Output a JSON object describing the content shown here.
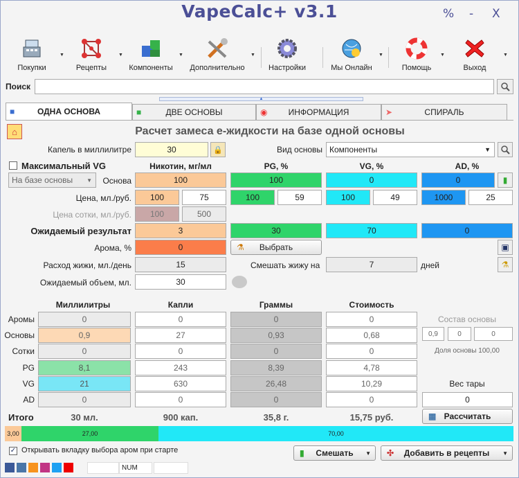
{
  "app": {
    "title": "VapeCalc+ v3.1",
    "ctl_percent": "%",
    "ctl_min": "-",
    "ctl_close": "X"
  },
  "toolbar": [
    {
      "label": "Покупки",
      "icon": "register-icon"
    },
    {
      "label": "Рецепты",
      "icon": "molecule-icon"
    },
    {
      "label": "Компоненты",
      "icon": "puzzle-icon"
    },
    {
      "label": "Дополнительно",
      "icon": "tools-icon"
    },
    {
      "label": "Настройки",
      "icon": "gear-icon"
    },
    {
      "label": "Мы Онлайн",
      "icon": "globe-icon"
    },
    {
      "label": "Помощь",
      "icon": "lifebuoy-icon"
    },
    {
      "label": "Выход",
      "icon": "exit-icon"
    }
  ],
  "search": {
    "label": "Поиск",
    "value": ""
  },
  "tabs": [
    {
      "label": "ОДНА ОСНОВА",
      "active": true
    },
    {
      "label": "ДВЕ ОСНОВЫ",
      "active": false
    },
    {
      "label": "ИНФОРМАЦИЯ",
      "active": false
    },
    {
      "label": "СПИРАЛЬ",
      "active": false
    }
  ],
  "heading": "Расчет замеса е-жидкости на базе одной основы",
  "drops": {
    "label": "Капель в миллилитре",
    "value": "30"
  },
  "base_type": {
    "label": "Вид основы",
    "value": "Компоненты"
  },
  "max_vg": {
    "label": "Максимальный VG",
    "checked": false
  },
  "base_select": "На базе основы",
  "col_headers": {
    "nic": "Никотин, мг/мл",
    "pg": "PG, %",
    "vg": "VG, %",
    "ad": "AD, %"
  },
  "rows": {
    "base": {
      "label": "Основа",
      "nic": "100",
      "pg": "100",
      "vg": "0",
      "ad": "0"
    },
    "price": {
      "label": "Цена, мл./руб.",
      "nic_ml": "100",
      "nic_rub": "75",
      "pg_ml": "100",
      "pg_rub": "59",
      "vg_ml": "100",
      "vg_rub": "49",
      "ad_ml": "1000",
      "ad_rub": "25"
    },
    "hundred": {
      "label": "Цена сотки, мл./руб.",
      "ml": "100",
      "rub": "500"
    },
    "expected": {
      "label": "Ожидаемый результат",
      "nic": "3",
      "pg": "30",
      "vg": "70",
      "ad": "0"
    },
    "aroma": {
      "label": "Арома, %",
      "value": "0",
      "choose": "Выбрать"
    },
    "consumption": {
      "label": "Расход жижи, мл./день",
      "value": "15"
    },
    "mix_days": {
      "label": "Смешать жижу на",
      "value": "7",
      "unit": "дней"
    },
    "volume": {
      "label": "Ожидаемый объем, мл.",
      "value": "30"
    }
  },
  "results": {
    "headers": {
      "ml": "Миллилитры",
      "drops": "Капли",
      "grams": "Граммы",
      "cost": "Стоимость"
    },
    "rows": [
      {
        "label": "Аромы",
        "ml": "0",
        "drops": "0",
        "grams": "0",
        "cost": "0"
      },
      {
        "label": "Основы",
        "ml": "0,9",
        "drops": "27",
        "grams": "0,93",
        "cost": "0,68"
      },
      {
        "label": "Сотки",
        "ml": "0",
        "drops": "0",
        "grams": "0",
        "cost": "0"
      },
      {
        "label": "PG",
        "ml": "8,1",
        "drops": "243",
        "grams": "8,39",
        "cost": "4,78"
      },
      {
        "label": "VG",
        "ml": "21",
        "drops": "630",
        "grams": "26,48",
        "cost": "10,29"
      },
      {
        "label": "AD",
        "ml": "0",
        "drops": "0",
        "grams": "0",
        "cost": "0"
      }
    ],
    "total": {
      "label": "Итого",
      "ml": "30 мл.",
      "drops": "900 кап.",
      "grams": "35,8 г.",
      "cost": "15,75 руб."
    }
  },
  "composition": {
    "label": "Состав основы",
    "v1": "0,9",
    "v2": "0",
    "v3": "0",
    "share": "Доля основы 100,00"
  },
  "tare": {
    "label": "Вес тары",
    "value": "0"
  },
  "calc_button": "Рассчитать",
  "mix_bar": {
    "nic": "3,00",
    "pg": "27,00",
    "vg": "70,00"
  },
  "open_aroma": {
    "label": "Открывать вкладку выбора аром при старте",
    "checked": true
  },
  "mix_button": "Смешать",
  "add_recipe_button": "Добавить в рецепты",
  "status": {
    "num": "NUM"
  },
  "colors": {
    "title": "#4b4f96",
    "nic": "#fdd9b5",
    "pg": "#2fd46a",
    "vg": "#21e8f7",
    "ad": "#1e96f2"
  }
}
